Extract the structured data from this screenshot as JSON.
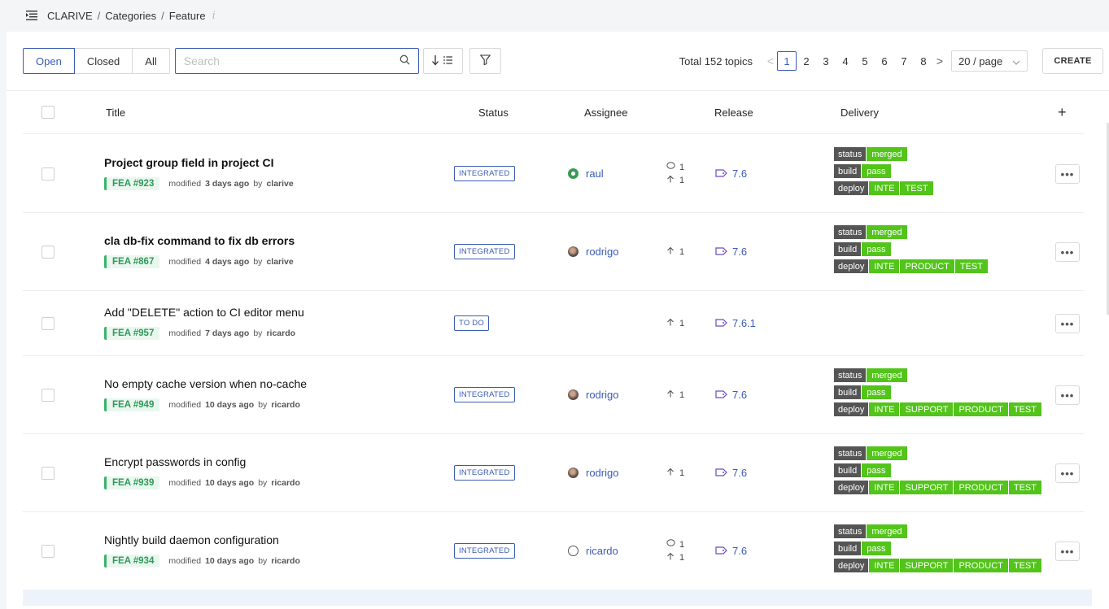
{
  "breadcrumb": [
    "CLARIVE",
    "Categories",
    "Feature"
  ],
  "breadcrumb_sep": "/",
  "info_glyph": "i",
  "filters": {
    "open": "Open",
    "closed": "Closed",
    "all": "All"
  },
  "search": {
    "placeholder": "Search",
    "value": ""
  },
  "pagination": {
    "total": "Total 152 topics",
    "pages": [
      "1",
      "2",
      "3",
      "4",
      "5",
      "6",
      "7",
      "8"
    ],
    "current": "1",
    "page_size": "20 / page",
    "prev": "<",
    "next": ">"
  },
  "create_label": "CREATE",
  "columns": {
    "title": "Title",
    "status": "Status",
    "assignee": "Assignee",
    "release": "Release",
    "delivery": "Delivery",
    "add": "+"
  },
  "meta_labels": {
    "modified": "modified",
    "by": "by"
  },
  "colors": {
    "accent": "#3b5bb5",
    "green": "#52c41a",
    "tag_green": "#39b36b",
    "dark_label": "#555555"
  },
  "rows": [
    {
      "title": "Project group field in project CI",
      "bold": true,
      "id": "FEA #923",
      "ago": "3 days ago",
      "author": "clarive",
      "status": "INTEGRATED",
      "assignee": "raul",
      "avatar": "green",
      "comments": "1",
      "upvotes": "1",
      "release": "7.6",
      "delivery": {
        "status": [
          "merged"
        ],
        "build": [
          "pass"
        ],
        "deploy": [
          "INTE",
          "TEST"
        ]
      }
    },
    {
      "title": "cla db-fix command to fix db errors",
      "bold": true,
      "id": "FEA #867",
      "ago": "4 days ago",
      "author": "clarive",
      "status": "INTEGRATED",
      "assignee": "rodrigo",
      "avatar": "photo",
      "comments": null,
      "upvotes": "1",
      "release": "7.6",
      "delivery": {
        "status": [
          "merged"
        ],
        "build": [
          "pass"
        ],
        "deploy": [
          "INTE",
          "PRODUCT",
          "TEST"
        ]
      }
    },
    {
      "title": "Add \"DELETE\" action to CI editor menu",
      "bold": false,
      "id": "FEA #957",
      "ago": "7 days ago",
      "author": "ricardo",
      "status": "TO DO",
      "assignee": null,
      "avatar": null,
      "comments": null,
      "upvotes": "1",
      "release": "7.6.1",
      "delivery": null
    },
    {
      "title": "No empty cache version when no-cache",
      "bold": false,
      "id": "FEA #949",
      "ago": "10 days ago",
      "author": "ricardo",
      "status": "INTEGRATED",
      "assignee": "rodrigo",
      "avatar": "photo",
      "comments": null,
      "upvotes": "1",
      "release": "7.6",
      "delivery": {
        "status": [
          "merged"
        ],
        "build": [
          "pass"
        ],
        "deploy": [
          "INTE",
          "SUPPORT",
          "PRODUCT",
          "TEST"
        ]
      }
    },
    {
      "title": "Encrypt passwords in config",
      "bold": false,
      "id": "FEA #939",
      "ago": "10 days ago",
      "author": "ricardo",
      "status": "INTEGRATED",
      "assignee": "rodrigo",
      "avatar": "photo",
      "comments": null,
      "upvotes": "1",
      "release": "7.6",
      "delivery": {
        "status": [
          "merged"
        ],
        "build": [
          "pass"
        ],
        "deploy": [
          "INTE",
          "SUPPORT",
          "PRODUCT",
          "TEST"
        ]
      }
    },
    {
      "title": "Nightly build daemon configuration",
      "bold": false,
      "id": "FEA #934",
      "ago": "10 days ago",
      "author": "ricardo",
      "status": "INTEGRATED",
      "assignee": "ricardo",
      "avatar": "eye",
      "comments": "1",
      "upvotes": "1",
      "release": "7.6",
      "delivery": {
        "status": [
          "merged"
        ],
        "build": [
          "pass"
        ],
        "deploy": [
          "INTE",
          "SUPPORT",
          "PRODUCT",
          "TEST"
        ]
      }
    }
  ],
  "delivery_labels": {
    "status": "status",
    "build": "build",
    "deploy": "deploy"
  },
  "more_glyph": "•••"
}
